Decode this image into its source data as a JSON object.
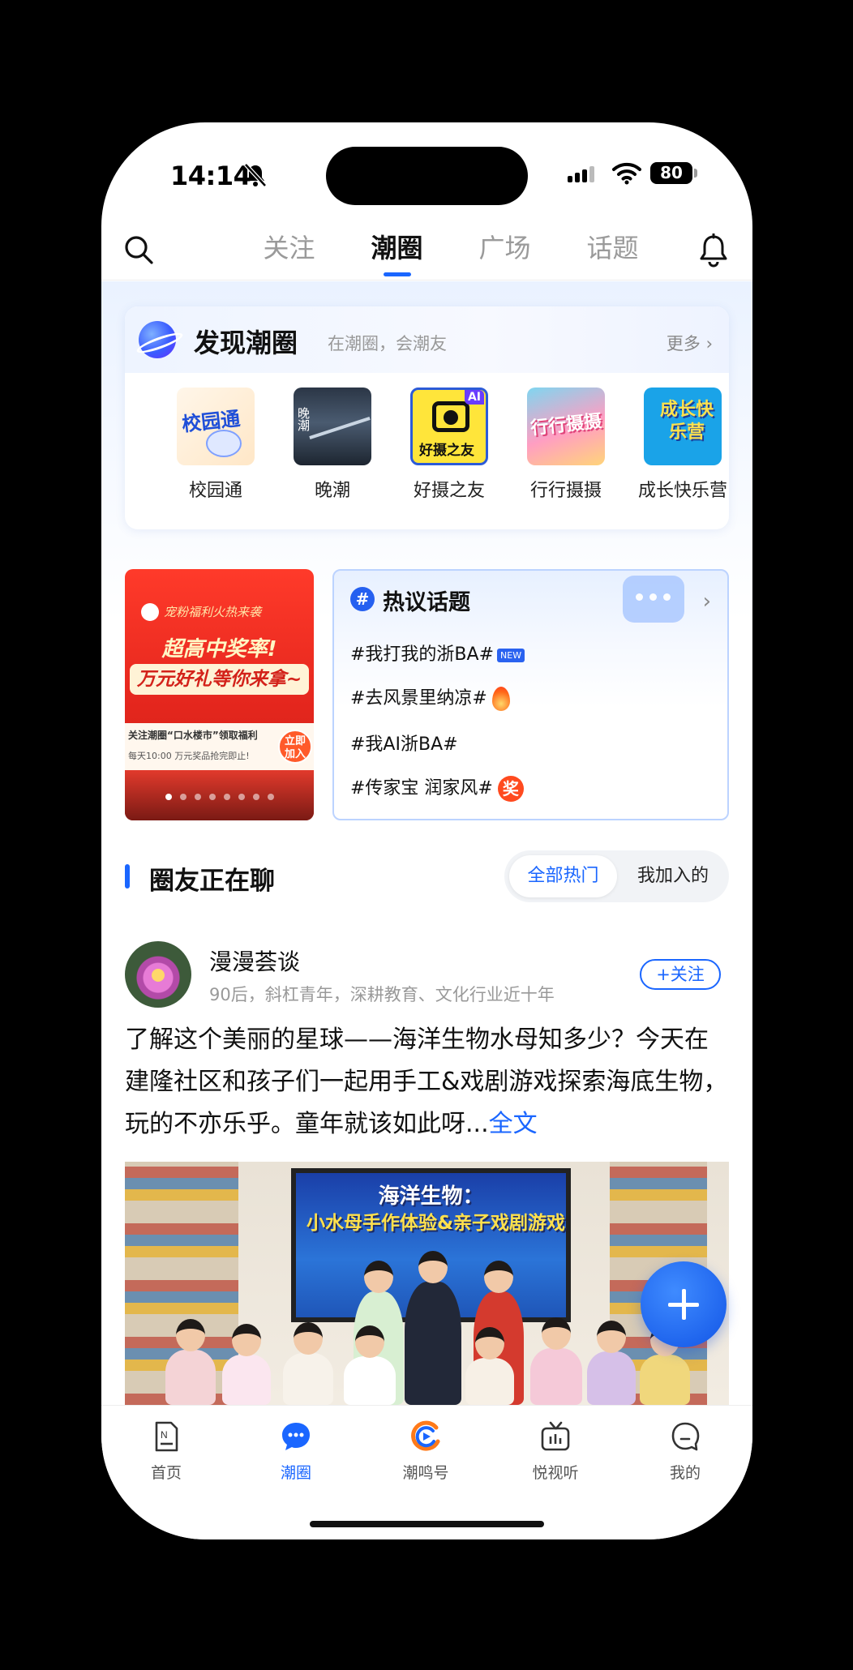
{
  "status_bar": {
    "time": "14:14",
    "battery": "80"
  },
  "topnav": {
    "tabs": [
      {
        "label": "关注",
        "active": false
      },
      {
        "label": "潮圈",
        "active": true
      },
      {
        "label": "广场",
        "active": false
      },
      {
        "label": "话题",
        "active": false
      }
    ]
  },
  "discover": {
    "title": "发现潮圈",
    "subtitle": "在潮圈，会潮友",
    "more": "更多 ›",
    "circles": [
      {
        "label": "校园通",
        "thumb_text": "校园通"
      },
      {
        "label": "晚潮",
        "thumb_text": "晚潮"
      },
      {
        "label": "好摄之友",
        "thumb_text": "好摄之友",
        "thumb_badge": "AI"
      },
      {
        "label": "行行摄摄",
        "thumb_text": "行行摄摄"
      },
      {
        "label": "成长快乐营",
        "thumb_text": "成长快乐营"
      }
    ]
  },
  "banner": {
    "tag": "宠粉福利火热来袭",
    "headline": "超高中奖率!",
    "subheadline": "万元好礼等你来拿~",
    "info_line1": "关注潮圈“口水楼市”领取福利",
    "info_line2": "每天10:00  万元奖品抢完即止!",
    "join": "立即加入",
    "page_count": 8,
    "active_page": 1
  },
  "hot_topics": {
    "title": "热议话题",
    "items": [
      {
        "text": "#我打我的浙BA#",
        "badge": "NEW"
      },
      {
        "text": "#去风景里纳凉#",
        "badge": "fire"
      },
      {
        "text": "#我AI浙BA#",
        "badge": ""
      },
      {
        "text": "#传家宝 润家风#",
        "badge": "奖"
      }
    ]
  },
  "chat_section": {
    "title": "圈友正在聊",
    "segments": [
      "全部热门",
      "我加入的"
    ],
    "active_segment": "全部热门"
  },
  "post": {
    "author": "漫漫荟谈",
    "bio": "90后，斜杠青年，深耕教育、文化行业近十年",
    "follow": "+关注",
    "text": "了解这个美丽的星球——海洋生物水母知多少？今天在建隆社区和孩子们一起用手工&戏剧游戏探索海底生物，玩的不亦乐乎。童年就该如此呀...",
    "full_link": "全文",
    "image_title": "海洋生物：",
    "image_subtitle": "小水母手作体验&亲子戏剧游戏"
  },
  "tabbar": {
    "items": [
      {
        "label": "首页",
        "icon": "news-icon",
        "active": false
      },
      {
        "label": "潮圈",
        "icon": "chat-bubble-icon",
        "active": true
      },
      {
        "label": "潮鸣号",
        "icon": "chaoming-logo-icon",
        "active": false
      },
      {
        "label": "悦视听",
        "icon": "tv-icon",
        "active": false
      },
      {
        "label": "我的",
        "icon": "profile-icon",
        "active": false
      }
    ]
  },
  "colors": {
    "accent": "#1a66ff",
    "banner_red": "#e4261d"
  }
}
